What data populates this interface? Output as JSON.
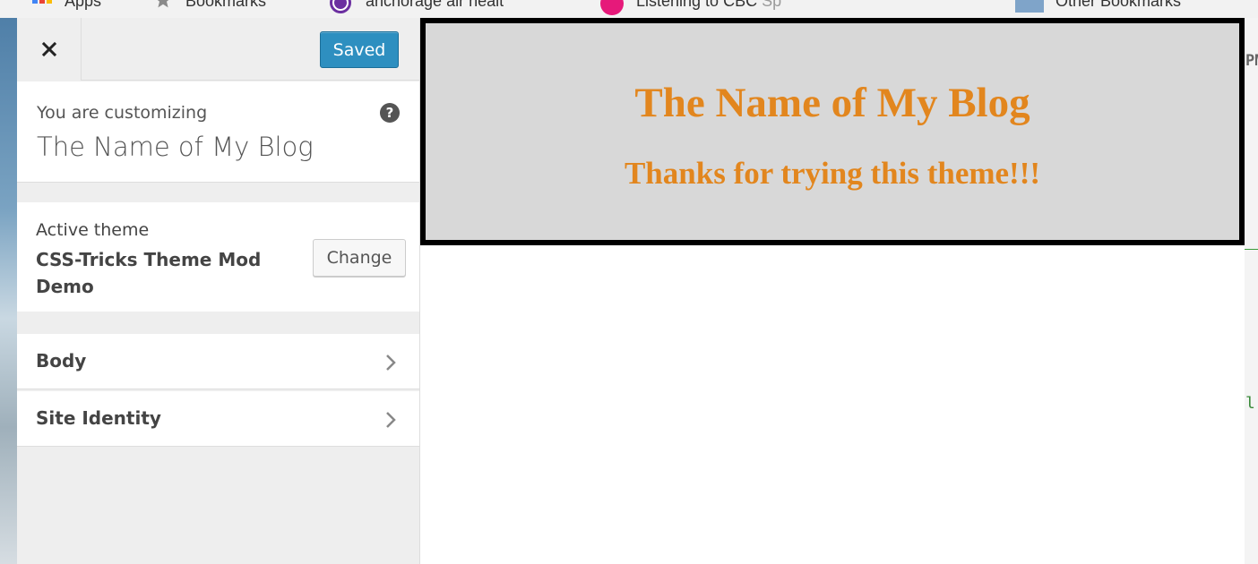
{
  "browser": {
    "bookmarks": [
      {
        "label": "Apps",
        "icon": "apps-grid-icon"
      },
      {
        "label": "Bookmarks",
        "icon": "star-icon"
      },
      {
        "label": "anchorage air healt",
        "icon": "peace-icon"
      },
      {
        "label": "Listening to CBC",
        "faded_suffix": "Sp",
        "icon": "cbc-icon"
      },
      {
        "label": "Other Bookmarks",
        "icon": "folder-icon"
      }
    ],
    "right_edge_fragments": [
      "PM",
      "l"
    ]
  },
  "customizer": {
    "close_icon": "close-icon",
    "save_button_label": "Saved",
    "customizing_label": "You are customizing",
    "site_title": "The Name of My Blog",
    "help_icon": "help-icon",
    "active_theme_label": "Active theme",
    "theme_name": "CSS-Tricks Theme Mod Demo",
    "change_button_label": "Change",
    "sections": [
      {
        "label": "Body",
        "icon": "chevron-right-icon"
      },
      {
        "label": "Site Identity",
        "icon": "chevron-right-icon"
      }
    ]
  },
  "preview": {
    "blog_title": "The Name of My Blog",
    "tagline": "Thanks for trying this theme!!!"
  },
  "colors": {
    "accent_blue": "#2e8fc0",
    "title_orange": "#e2861e",
    "header_gray": "#d8d8d8"
  }
}
